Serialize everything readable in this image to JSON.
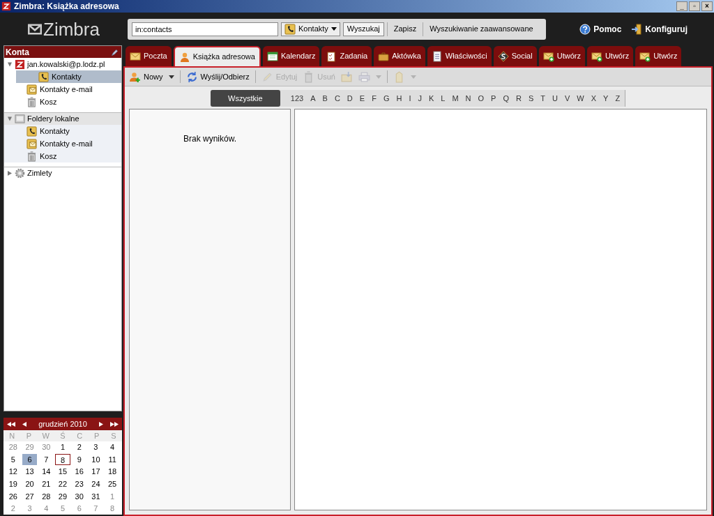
{
  "window": {
    "title": "Zimbra: Książka adresowa",
    "controls": [
      "_",
      "▫",
      "×"
    ]
  },
  "logo": {
    "text": "Zimbra"
  },
  "search": {
    "value": "in:contacts",
    "scope": "Kontakty",
    "buttons": [
      "Wyszukaj",
      "Zapisz",
      "Wyszukiwanie zaawansowane"
    ]
  },
  "header_links": [
    {
      "kind": "help",
      "label": "Pomoc"
    },
    {
      "kind": "settings",
      "label": "Konfiguruj"
    }
  ],
  "tabs": [
    {
      "kind": "mail",
      "label": "Poczta",
      "selected": false
    },
    {
      "kind": "contacts",
      "label": "Książka adresowa",
      "selected": true
    },
    {
      "kind": "calendar",
      "label": "Kalendarz",
      "selected": false
    },
    {
      "kind": "tasks",
      "label": "Zadania",
      "selected": false
    },
    {
      "kind": "briefcase",
      "label": "Aktówka",
      "selected": false
    },
    {
      "kind": "prefs",
      "label": "Właściwości",
      "selected": false
    },
    {
      "kind": "social",
      "label": "Social",
      "selected": false
    },
    {
      "kind": "compose",
      "label": "Utwórz",
      "selected": false
    },
    {
      "kind": "compose",
      "label": "Utwórz",
      "selected": false
    },
    {
      "kind": "compose",
      "label": "Utwórz",
      "selected": false
    }
  ],
  "toolbar": [
    {
      "kind": "new",
      "label": "Nowy",
      "dropdown": true,
      "disabled": false
    },
    {
      "kind": "sync",
      "label": "Wyślij/Odbierz",
      "dropdown": false,
      "disabled": false
    },
    {
      "kind": "edit",
      "label": "Edytuj",
      "dropdown": false,
      "disabled": true
    },
    {
      "kind": "delete",
      "label": "Usuń",
      "dropdown": false,
      "disabled": true
    },
    {
      "kind": "move",
      "dropdown": false,
      "disabled": true
    },
    {
      "kind": "print",
      "dropdown": true,
      "disabled": true
    },
    {
      "kind": "tag",
      "dropdown": true,
      "disabled": true
    }
  ],
  "alphabet": [
    {
      "label": "Wszystkie",
      "selected": true
    },
    {
      "label": "123",
      "selected": false
    },
    {
      "label": "A",
      "selected": false
    },
    {
      "label": "B",
      "selected": false
    },
    {
      "label": "C",
      "selected": false
    },
    {
      "label": "D",
      "selected": false
    },
    {
      "label": "E",
      "selected": false
    },
    {
      "label": "F",
      "selected": false
    },
    {
      "label": "G",
      "selected": false
    },
    {
      "label": "H",
      "selected": false
    },
    {
      "label": "I",
      "selected": false
    },
    {
      "label": "J",
      "selected": false
    },
    {
      "label": "K",
      "selected": false
    },
    {
      "label": "L",
      "selected": false
    },
    {
      "label": "M",
      "selected": false
    },
    {
      "label": "N",
      "selected": false
    },
    {
      "label": "O",
      "selected": false
    },
    {
      "label": "P",
      "selected": false
    },
    {
      "label": "Q",
      "selected": false
    },
    {
      "label": "R",
      "selected": false
    },
    {
      "label": "S",
      "selected": false
    },
    {
      "label": "T",
      "selected": false
    },
    {
      "label": "U",
      "selected": false
    },
    {
      "label": "V",
      "selected": false
    },
    {
      "label": "W",
      "selected": false
    },
    {
      "label": "X",
      "selected": false
    },
    {
      "label": "Y",
      "selected": false
    },
    {
      "label": "Z",
      "selected": false
    }
  ],
  "contact_list": {
    "empty_message": "Brak wyników."
  },
  "sidebar": {
    "title": "Konta",
    "groups": [
      {
        "kind": "account",
        "label": "jan.kowalski@p.lodz.pl",
        "expanded": true,
        "children": [
          {
            "kind": "contacts",
            "label": "Kontakty",
            "selected": true
          },
          {
            "kind": "emailed",
            "label": "Kontakty e-mail",
            "selected": false
          },
          {
            "kind": "trash",
            "label": "Kosz",
            "selected": false
          }
        ]
      },
      {
        "kind": "local",
        "label": "Foldery lokalne",
        "expanded": true,
        "children": [
          {
            "kind": "contacts",
            "label": "Kontakty",
            "selected": false
          },
          {
            "kind": "emailed",
            "label": "Kontakty e-mail",
            "selected": false
          },
          {
            "kind": "trash",
            "label": "Kosz",
            "selected": false
          }
        ]
      },
      {
        "kind": "zimlets",
        "label": "Zimlety",
        "expanded": false
      }
    ]
  },
  "calendar": {
    "month": "grudzień 2010",
    "weekdays": [
      "N",
      "P",
      "W",
      "Ś",
      "C",
      "P",
      "S"
    ],
    "weeks": [
      [
        {
          "d": "28",
          "muted": true,
          "selected": false,
          "today": false
        },
        {
          "d": "29",
          "muted": true,
          "selected": false,
          "today": false
        },
        {
          "d": "30",
          "muted": true,
          "selected": false,
          "today": false
        },
        {
          "d": "1",
          "muted": false,
          "selected": false,
          "today": false
        },
        {
          "d": "2",
          "muted": false,
          "selected": false,
          "today": false
        },
        {
          "d": "3",
          "muted": false,
          "selected": false,
          "today": false
        },
        {
          "d": "4",
          "muted": false,
          "selected": false,
          "today": false
        }
      ],
      [
        {
          "d": "5",
          "muted": false,
          "selected": false,
          "today": false
        },
        {
          "d": "6",
          "muted": false,
          "selected": true,
          "today": false
        },
        {
          "d": "7",
          "muted": false,
          "selected": false,
          "today": false
        },
        {
          "d": "8",
          "muted": false,
          "selected": false,
          "today": true
        },
        {
          "d": "9",
          "muted": false,
          "selected": false,
          "today": false
        },
        {
          "d": "10",
          "muted": false,
          "selected": false,
          "today": false
        },
        {
          "d": "11",
          "muted": false,
          "selected": false,
          "today": false
        }
      ],
      [
        {
          "d": "12",
          "muted": false,
          "selected": false,
          "today": false
        },
        {
          "d": "13",
          "muted": false,
          "selected": false,
          "today": false
        },
        {
          "d": "14",
          "muted": false,
          "selected": false,
          "today": false
        },
        {
          "d": "15",
          "muted": false,
          "selected": false,
          "today": false
        },
        {
          "d": "16",
          "muted": false,
          "selected": false,
          "today": false
        },
        {
          "d": "17",
          "muted": false,
          "selected": false,
          "today": false
        },
        {
          "d": "18",
          "muted": false,
          "selected": false,
          "today": false
        }
      ],
      [
        {
          "d": "19",
          "muted": false,
          "selected": false,
          "today": false
        },
        {
          "d": "20",
          "muted": false,
          "selected": false,
          "today": false
        },
        {
          "d": "21",
          "muted": false,
          "selected": false,
          "today": false
        },
        {
          "d": "22",
          "muted": false,
          "selected": false,
          "today": false
        },
        {
          "d": "23",
          "muted": false,
          "selected": false,
          "today": false
        },
        {
          "d": "24",
          "muted": false,
          "selected": false,
          "today": false
        },
        {
          "d": "25",
          "muted": false,
          "selected": false,
          "today": false
        }
      ],
      [
        {
          "d": "26",
          "muted": false,
          "selected": false,
          "today": false
        },
        {
          "d": "27",
          "muted": false,
          "selected": false,
          "today": false
        },
        {
          "d": "28",
          "muted": false,
          "selected": false,
          "today": false
        },
        {
          "d": "29",
          "muted": false,
          "selected": false,
          "today": false
        },
        {
          "d": "30",
          "muted": false,
          "selected": false,
          "today": false
        },
        {
          "d": "31",
          "muted": false,
          "selected": false,
          "today": false
        },
        {
          "d": "1",
          "muted": true,
          "selected": false,
          "today": false
        }
      ],
      [
        {
          "d": "2",
          "muted": true,
          "selected": false,
          "today": false
        },
        {
          "d": "3",
          "muted": true,
          "selected": false,
          "today": false
        },
        {
          "d": "4",
          "muted": true,
          "selected": false,
          "today": false
        },
        {
          "d": "5",
          "muted": true,
          "selected": false,
          "today": false
        },
        {
          "d": "6",
          "muted": true,
          "selected": false,
          "today": false
        },
        {
          "d": "7",
          "muted": true,
          "selected": false,
          "today": false
        },
        {
          "d": "8",
          "muted": true,
          "selected": false,
          "today": false
        }
      ]
    ]
  }
}
